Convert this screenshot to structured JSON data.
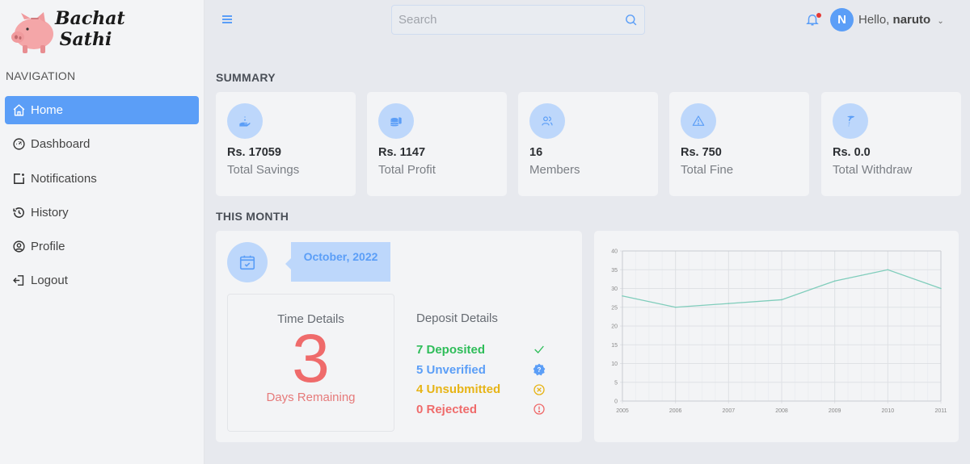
{
  "brand": {
    "line1": "Bachat",
    "line2": "Sathi"
  },
  "sidebar": {
    "heading": "NAVIGATION",
    "items": [
      {
        "label": "Home",
        "icon": "home-icon",
        "active": true
      },
      {
        "label": "Dashboard",
        "icon": "dashboard-icon",
        "active": false
      },
      {
        "label": "Notifications",
        "icon": "notification-icon",
        "active": false
      },
      {
        "label": "History",
        "icon": "history-icon",
        "active": false
      },
      {
        "label": "Profile",
        "icon": "profile-icon",
        "active": false
      },
      {
        "label": "Logout",
        "icon": "logout-icon",
        "active": false
      }
    ]
  },
  "topbar": {
    "search_placeholder": "Search",
    "search_value": "",
    "avatar_initial": "N",
    "greeting_prefix": "Hello,",
    "username": "naruto",
    "caret": "⌄"
  },
  "summary": {
    "title": "SUMMARY",
    "cards": [
      {
        "value": "Rs. 17059",
        "label": "Total Savings",
        "icon": "savings-hand-icon"
      },
      {
        "value": "Rs. 1147",
        "label": "Total Profit",
        "icon": "coins-icon"
      },
      {
        "value": "16",
        "label": "Members",
        "icon": "members-icon"
      },
      {
        "value": "Rs. 750",
        "label": "Total Fine",
        "icon": "warning-icon"
      },
      {
        "value": "Rs. 0.0",
        "label": "Total Withdraw",
        "icon": "withdraw-icon"
      }
    ]
  },
  "this_month": {
    "title": "THIS MONTH",
    "month": "October, 2022",
    "time_details": {
      "title": "Time Details",
      "days": "3",
      "subtitle": "Days Remaining"
    },
    "deposit_details": {
      "title": "Deposit Details",
      "rows": [
        {
          "label": "7 Deposited",
          "color": "#2ebd59",
          "icon": "check-icon"
        },
        {
          "label": "5 Unverified",
          "color": "#5b9ef7",
          "icon": "question-badge-icon"
        },
        {
          "label": "4 Unsubmitted",
          "color": "#e7b416",
          "icon": "x-circle-icon"
        },
        {
          "label": "0 Rejected",
          "color": "#ef6b6b",
          "icon": "exclamation-circle-icon"
        }
      ]
    }
  },
  "colors": {
    "accent": "#5b9ef7",
    "accent_light": "#bdd7fb",
    "line": "#7fcdbb"
  },
  "chart_data": {
    "type": "line",
    "title": "",
    "xlabel": "",
    "ylabel": "",
    "x": [
      "2005",
      "2006",
      "2007",
      "2008",
      "2009",
      "2010",
      "2011"
    ],
    "series": [
      {
        "name": "",
        "values": [
          28,
          25,
          26,
          27,
          32,
          35,
          30
        ]
      }
    ],
    "ylim": [
      0,
      40
    ],
    "yticks": [
      0,
      5,
      10,
      15,
      20,
      25,
      30,
      35,
      40
    ],
    "grid": true,
    "legend": "none"
  }
}
